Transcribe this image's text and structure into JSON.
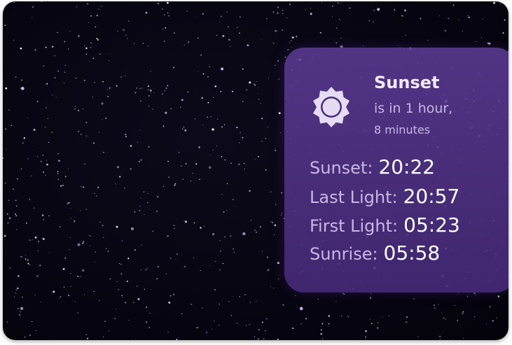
{
  "widget": {
    "title": "Sunset",
    "subtitle_line1": "is in 1 hour,",
    "subtitle_line2": "8 minutes",
    "icon": "sun-icon",
    "times": [
      {
        "label": "Sunset:",
        "value": "20:22"
      },
      {
        "label": "Last Light:",
        "value": "20:57"
      },
      {
        "label": "First Light:",
        "value": "05:23"
      },
      {
        "label": "Sunrise:",
        "value": "05:58"
      }
    ]
  },
  "colors": {
    "background": "#06040f",
    "card": "#5c3a94",
    "label": "#c9b6e6",
    "value": "#ffffff",
    "icon_fill": "#e6dcf2"
  }
}
